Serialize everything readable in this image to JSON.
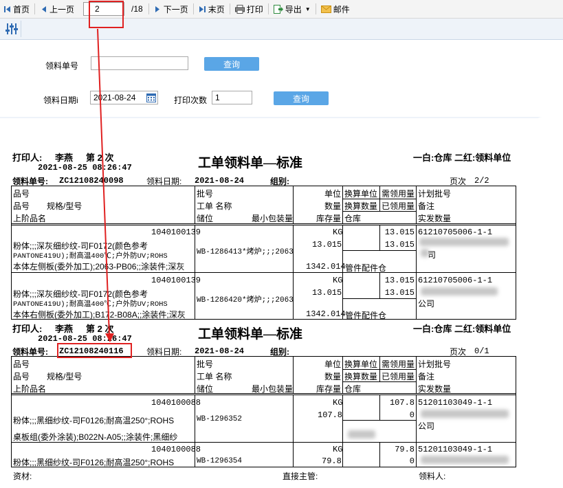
{
  "toolbar": {
    "first": "首页",
    "prev": "上一页",
    "page_value": "2",
    "page_total": "/18",
    "next": "下一页",
    "last": "末页",
    "print": "打印",
    "export": "导出",
    "mail": "邮件"
  },
  "form": {
    "order_no_label": "领料单号",
    "order_no_value": "",
    "query1": "查询",
    "date_label": "领料日期i",
    "date_value": "2021-08-24",
    "print_count_label": "打印次数",
    "print_count_value": "1",
    "query2": "查询"
  },
  "report": {
    "title": "工单领料单—标准",
    "printer_label": "打印人:",
    "printer_name": "李燕",
    "print_times": "第 2 次",
    "copy_note": "一白:仓库 二红:领料单位",
    "order_no_label": "领料单号:",
    "date_label": "领料日期:",
    "group_label": "组别:",
    "headers": {
      "c1a": "品号",
      "c1b": "品号",
      "c1b2": "规格/型号",
      "c1c": "上阶品名",
      "c2a": "批号",
      "c2b": "工单 名称",
      "c2c1": "储位",
      "c2c2": "最小包装量",
      "c3a": "单位",
      "c3b": "数量",
      "c3c": "库存量",
      "c4a": "换算单位",
      "c4b": "换算数量",
      "c4c": "仓库",
      "c5a": "需领用量",
      "c5b": "已领用量",
      "c6a": "计划批号",
      "c6b": "备注",
      "c6c": "实发数量"
    },
    "sections": [
      {
        "print_time": "2021-08-25 08:26:47",
        "order_no": "ZC12108240098",
        "date": "2021-08-24",
        "page_label": "页次",
        "page": "2/2",
        "rows": [
          {
            "code": "1040100139",
            "line1": "粉体;;;深灰细纱纹-司F0172(颜色参考",
            "line2": "PANTONE419U);耐高温400℃;户外防UV;ROHS",
            "line3": "本体左侧板(委外加工);2063-PB06;;涂装件;深灰",
            "batch": "WB-1286413*烤炉;;;2063",
            "unit": "KG",
            "qty": "13.015",
            "stock": "1342.014",
            "warehouse": "管件配件仓",
            "need": "13.015",
            "received": "13.015",
            "plan": "61210705006-1-1",
            "note": "司"
          },
          {
            "code": "1040100139",
            "line1": "粉体;;;深灰细纱纹-司F0172(颜色参考",
            "line2": "PANTONE419U);耐高温400℃;户外防UV;ROHS",
            "line3": "本体右侧板(委外加工);B172-B08A;;涂装件;深灰",
            "batch": "WB-1286420*烤炉;;;2063",
            "unit": "KG",
            "qty": "13.015",
            "stock": "1342.014",
            "warehouse": "管件配件仓",
            "need": "13.015",
            "received": "13.015",
            "plan": "61210705006-1-1",
            "note": "公司"
          }
        ]
      },
      {
        "print_time": "2021-08-25 08:26:47",
        "order_no": "ZC12108240116",
        "date": "2021-08-24",
        "page_label": "页次",
        "page": "0/1",
        "rows": [
          {
            "code": "1040100088",
            "line1": "粉体;;;黑细纱纹-司F0126;耐高温250°;ROHS",
            "line3": "桌板组(委外涂装);B022N-A05;;涂装件;黑细纱",
            "batch": "WB-1296352",
            "unit": "KG",
            "qty": "107.8",
            "need": "107.8",
            "received": "0",
            "plan": "51201103049-1-1",
            "note": "公司"
          },
          {
            "code": "1040100088",
            "line1": "粉体;;;黑细纱纹-司F0126;耐高温250°;ROHS",
            "batch": "WB-1296354",
            "unit": "KG",
            "qty": "79.8",
            "need": "79.8",
            "received": "0",
            "plan": "51201103049-1-1"
          }
        ]
      }
    ],
    "footer": {
      "material": "资材:",
      "supervisor": "直接主管:",
      "receiver": "领料人:"
    }
  },
  "colors": {
    "query_button": "#5aa6e6",
    "highlight": "#e02020",
    "toolbar_icon": "#2f6bb3"
  }
}
